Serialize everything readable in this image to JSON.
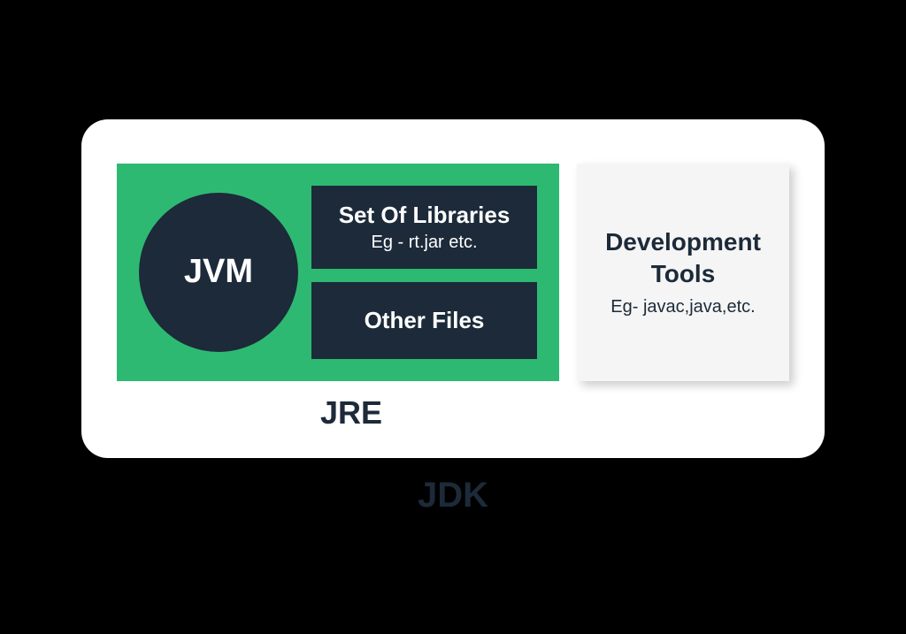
{
  "diagram": {
    "jdk_label": "JDK",
    "jre_label": "JRE",
    "jvm_label": "JVM",
    "libraries_title": "Set Of Libraries",
    "libraries_sub": "Eg - rt.jar etc.",
    "other_files_label": "Other Files",
    "dev_tools_title": "Development Tools",
    "dev_tools_sub": "Eg- javac,java,etc."
  }
}
